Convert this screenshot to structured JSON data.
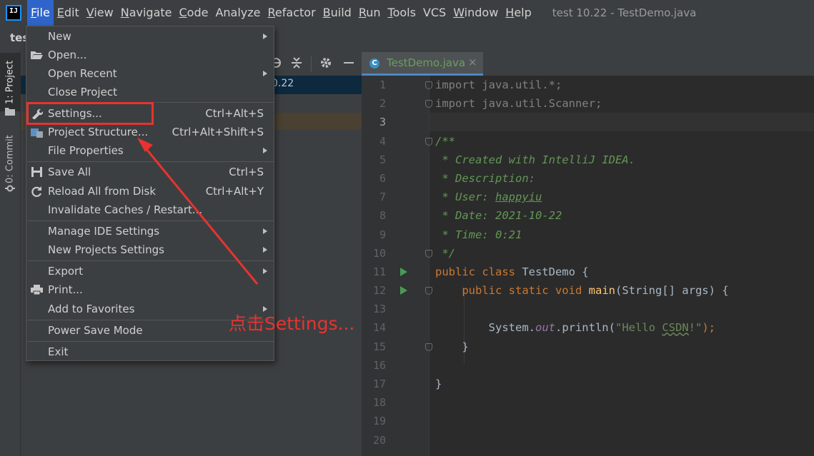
{
  "menubar": {
    "logo_text": "IJ",
    "items": [
      {
        "label": "File",
        "mnemonic": "F",
        "rest": "ile"
      },
      {
        "label": "Edit",
        "mnemonic": "E",
        "rest": "dit"
      },
      {
        "label": "View",
        "mnemonic": "V",
        "rest": "iew"
      },
      {
        "label": "Navigate",
        "mnemonic": "N",
        "rest": "avigate"
      },
      {
        "label": "Code",
        "mnemonic": "C",
        "rest": "ode"
      },
      {
        "label": "Analyze",
        "mnemonic": "",
        "rest": "Analyze"
      },
      {
        "label": "Refactor",
        "mnemonic": "R",
        "rest": "efactor"
      },
      {
        "label": "Build",
        "mnemonic": "B",
        "rest": "uild"
      },
      {
        "label": "Run",
        "mnemonic": "R",
        "rest": "un"
      },
      {
        "label": "Tools",
        "mnemonic": "T",
        "rest": "ools"
      },
      {
        "label": "VCS",
        "mnemonic": "",
        "rest": "VCS"
      },
      {
        "label": "Window",
        "mnemonic": "W",
        "rest": "indow"
      },
      {
        "label": "Help",
        "mnemonic": "H",
        "rest": "elp"
      }
    ],
    "window_title": "test 10.22 - TestDemo.java"
  },
  "navbar": {
    "crumb": "tes"
  },
  "toolstrip": {
    "project_tab": "1: Project",
    "commit_tab": "0: Commit"
  },
  "project_panel": {
    "selected_row_text": "0.22"
  },
  "editor": {
    "tab_label": "TestDemo.java",
    "tab_close": "×",
    "tab_icon_letter": "C"
  },
  "file_menu": {
    "items": [
      {
        "label": "New",
        "shortcut": "",
        "submenu": true,
        "icon": ""
      },
      {
        "label": "Open...",
        "shortcut": "",
        "submenu": false,
        "icon": "folder-icon"
      },
      {
        "label": "Open Recent",
        "shortcut": "",
        "submenu": true,
        "icon": ""
      },
      {
        "label": "Close Project",
        "shortcut": "",
        "submenu": false,
        "icon": ""
      },
      {
        "label": "Settings...",
        "shortcut": "Ctrl+Alt+S",
        "submenu": false,
        "icon": "wrench-icon"
      },
      {
        "label": "Project Structure...",
        "shortcut": "Ctrl+Alt+Shift+S",
        "submenu": false,
        "icon": "project-structure-icon"
      },
      {
        "label": "File Properties",
        "shortcut": "",
        "submenu": true,
        "icon": ""
      },
      {
        "label": "Save All",
        "shortcut": "Ctrl+S",
        "submenu": false,
        "icon": "save-icon"
      },
      {
        "label": "Reload All from Disk",
        "shortcut": "Ctrl+Alt+Y",
        "submenu": false,
        "icon": "reload-icon"
      },
      {
        "label": "Invalidate Caches / Restart...",
        "shortcut": "",
        "submenu": false,
        "icon": ""
      },
      {
        "label": "Manage IDE Settings",
        "shortcut": "",
        "submenu": true,
        "icon": ""
      },
      {
        "label": "New Projects Settings",
        "shortcut": "",
        "submenu": true,
        "icon": ""
      },
      {
        "label": "Export",
        "shortcut": "",
        "submenu": true,
        "icon": ""
      },
      {
        "label": "Print...",
        "shortcut": "",
        "submenu": false,
        "icon": "print-icon"
      },
      {
        "label": "Add to Favorites",
        "shortcut": "",
        "submenu": true,
        "icon": ""
      },
      {
        "label": "Power Save Mode",
        "shortcut": "",
        "submenu": false,
        "icon": ""
      },
      {
        "label": "Exit",
        "shortcut": "",
        "submenu": false,
        "icon": ""
      }
    ]
  },
  "code_lines": [
    {
      "n": "1"
    },
    {
      "n": "2"
    },
    {
      "n": "3"
    },
    {
      "n": "4"
    },
    {
      "n": "5"
    },
    {
      "n": "6"
    },
    {
      "n": "7"
    },
    {
      "n": "8"
    },
    {
      "n": "9"
    },
    {
      "n": "10"
    },
    {
      "n": "11"
    },
    {
      "n": "12"
    },
    {
      "n": "13"
    },
    {
      "n": "14"
    },
    {
      "n": "15"
    },
    {
      "n": "16"
    },
    {
      "n": "17"
    },
    {
      "n": "18"
    },
    {
      "n": "19"
    },
    {
      "n": "20"
    }
  ],
  "code": {
    "l1_kw": "import",
    "l1_rest": " java.util.*;",
    "l2_kw": "import",
    "l2_rest": " java.util.Scanner;",
    "l4": "/**",
    "l5": " * Created with IntelliJ IDEA.",
    "l6": " * Description:",
    "l7_pre": " * User: ",
    "l7_user": "happyiu",
    "l8": " * Date: 2021-10-22",
    "l9": " * Time: 0:21",
    "l10": " */",
    "l11_kw": "public class",
    "l11_rest": " TestDemo {",
    "l12_kw": "public static void",
    "l12_fn": "main",
    "l12_rest": "(String[] args) {",
    "l14_pre": "System.",
    "l14_fld": "out",
    "l14_mid": ".println(",
    "l14_str_a": "\"Hello ",
    "l14_str_b": "CSDN",
    "l14_str_c": "!\"",
    "l14_end": ");",
    "l15": "}",
    "l17": "}"
  },
  "annotation": {
    "text": "点击Settings..."
  },
  "colors": {
    "highlight": "#2f65ca",
    "annotation_red": "#e8332f",
    "background": "#2b2b2b"
  }
}
